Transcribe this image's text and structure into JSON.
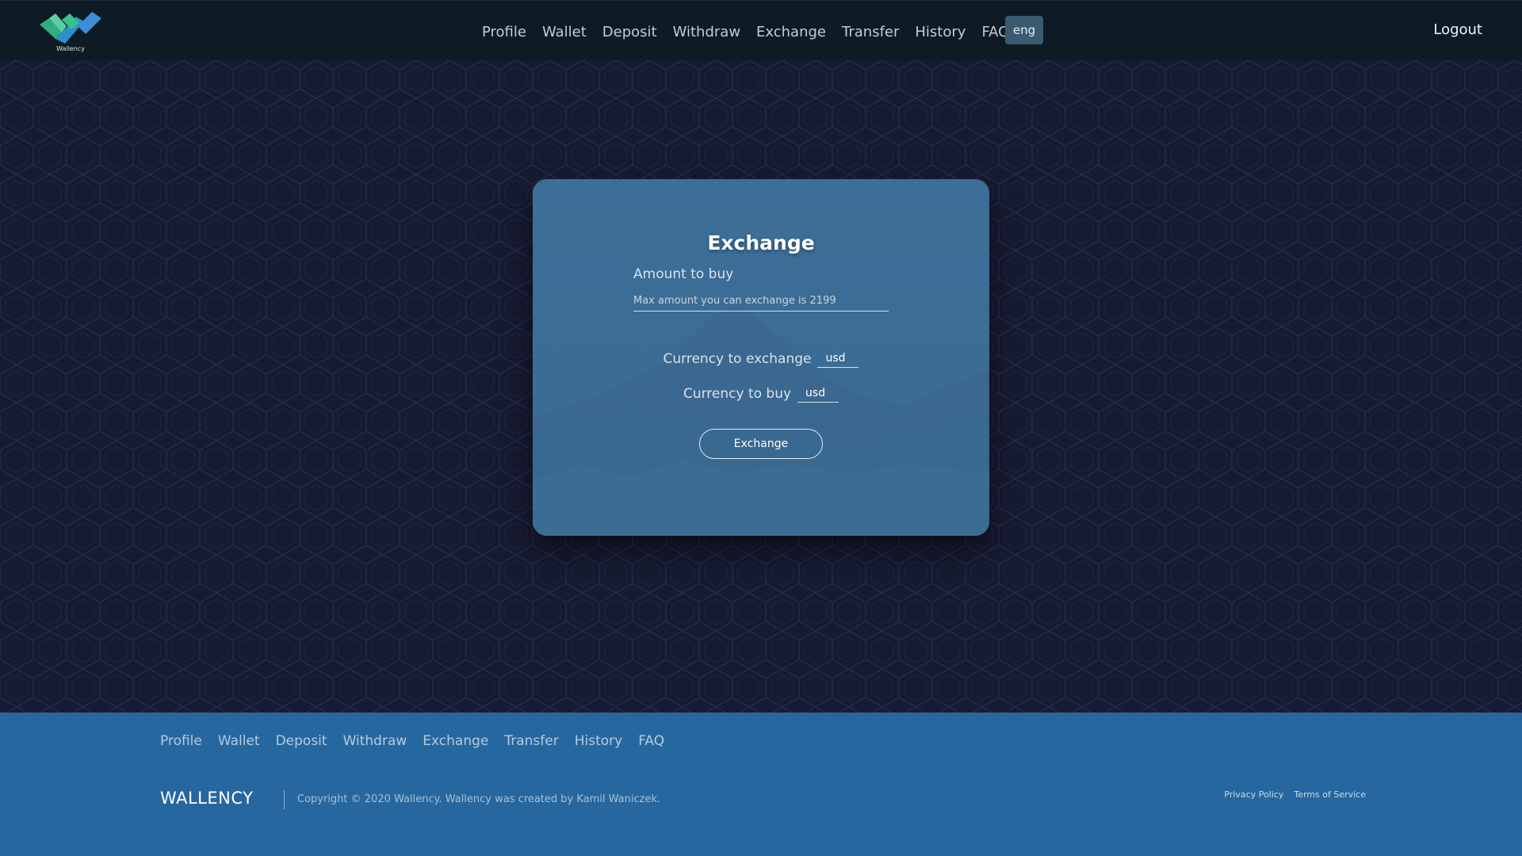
{
  "header": {
    "logo_text": "Wallency",
    "nav": [
      "Profile",
      "Wallet",
      "Deposit",
      "Withdraw",
      "Exchange",
      "Transfer",
      "History",
      "FAQ"
    ],
    "language": "eng",
    "logout": "Logout"
  },
  "exchange_form": {
    "title": "Exchange",
    "amount_label": "Amount to buy",
    "amount_placeholder": "Max amount you can exchange is 2199",
    "amount_value": "",
    "currency_exchange_label": "Currency to exchange",
    "currency_exchange_value": "usd",
    "currency_buy_label": "Currency to buy",
    "currency_buy_value": "usd",
    "submit_label": "Exchange"
  },
  "footer": {
    "nav": [
      "Profile",
      "Wallet",
      "Deposit",
      "Withdraw",
      "Exchange",
      "Transfer",
      "History",
      "FAQ"
    ],
    "brand": "WALLENCY",
    "copyright": "Copyright © 2020 Wallency. Wallency was created by Kamil Waniczek.",
    "privacy": "Privacy Policy",
    "terms": "Terms of Service"
  },
  "colors": {
    "header_bg": "#0e1b24",
    "page_bg": "#171b31",
    "card_bg": "#3b6d94",
    "footer_bg": "#2767a0",
    "lang_button_bg": "#3a5a70"
  }
}
